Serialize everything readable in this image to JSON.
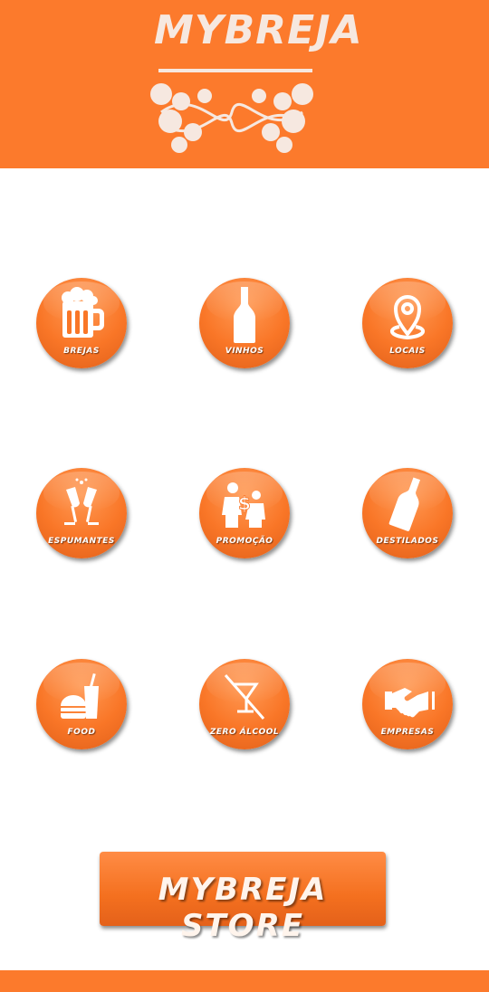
{
  "colors": {
    "accent": "#fc7a2c",
    "background": "#ffffff"
  },
  "header": {
    "logo_text": "MYBREJA"
  },
  "menu": [
    {
      "label": "BREJAS",
      "icon": "beer-mug-icon"
    },
    {
      "label": "VINHOS",
      "icon": "wine-bottle-icon"
    },
    {
      "label": "LOCAIS",
      "icon": "map-pin-icon"
    },
    {
      "label": "ESPUMANTES",
      "icon": "champagne-glasses-icon"
    },
    {
      "label": "PROMOÇÃO",
      "icon": "promotion-dollar-icon"
    },
    {
      "label": "DESTILADOS",
      "icon": "liquor-bottle-icon"
    },
    {
      "label": "FOOD",
      "icon": "burger-drink-icon"
    },
    {
      "label": "ZERO ÁLCOOL",
      "icon": "no-alcohol-icon"
    },
    {
      "label": "EMPRESAS",
      "icon": "handshake-icon"
    }
  ],
  "store_button": {
    "label": "MYBREJA STORE"
  }
}
